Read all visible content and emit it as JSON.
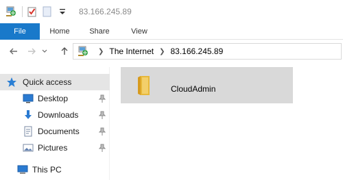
{
  "window": {
    "title": "83.166.245.89"
  },
  "quick_access_toolbar": {
    "icons": [
      "network-location-icon",
      "properties-icon",
      "new-folder-icon",
      "customize-dropdown-icon"
    ]
  },
  "ribbon": {
    "tabs": [
      {
        "label": "File"
      },
      {
        "label": "Home"
      },
      {
        "label": "Share"
      },
      {
        "label": "View"
      }
    ],
    "file_color": "#1979ca"
  },
  "address": {
    "crumbs": [
      "The Internet",
      "83.166.245.89"
    ]
  },
  "nav_pane": {
    "items": [
      {
        "label": "Quick access",
        "icon": "star-icon",
        "selected": true
      },
      {
        "label": "Desktop",
        "icon": "desktop-icon",
        "pinned": true
      },
      {
        "label": "Downloads",
        "icon": "download-arrow-icon",
        "pinned": true
      },
      {
        "label": "Documents",
        "icon": "document-icon",
        "pinned": true
      },
      {
        "label": "Pictures",
        "icon": "pictures-icon",
        "pinned": true
      },
      {
        "label": "This PC",
        "icon": "computer-icon"
      }
    ]
  },
  "content": {
    "items": [
      {
        "label": "CloudAdmin",
        "icon": "folder-icon",
        "selected": true
      }
    ]
  }
}
